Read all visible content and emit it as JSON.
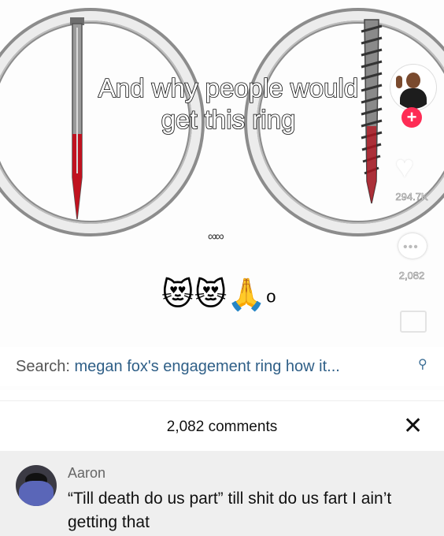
{
  "video": {
    "caption_line1": "And why people would",
    "caption_line2": "get this ring",
    "link_glyph": "∞∞",
    "emoji": "😻😻🙏",
    "emoji_tail": "o",
    "like_count": "294.7K",
    "comment_count": "2,082",
    "icons": [
      "link-icon",
      "heart-icon",
      "comment-icon",
      "share-icon",
      "follow-plus-icon"
    ]
  },
  "search": {
    "label": "Search:",
    "query": "megan fox's engagement ring how it..."
  },
  "comments": {
    "header": "2,082 comments",
    "close_glyph": "✕",
    "items": [
      {
        "author": "Aaron",
        "text": "“Till death do us part” till shit do us fart I ain’t getting that"
      }
    ]
  },
  "colors": {
    "accent_plus": "#fe2c55",
    "search_query": "#2f5f87",
    "comment_panel_bg": "#efefef"
  }
}
